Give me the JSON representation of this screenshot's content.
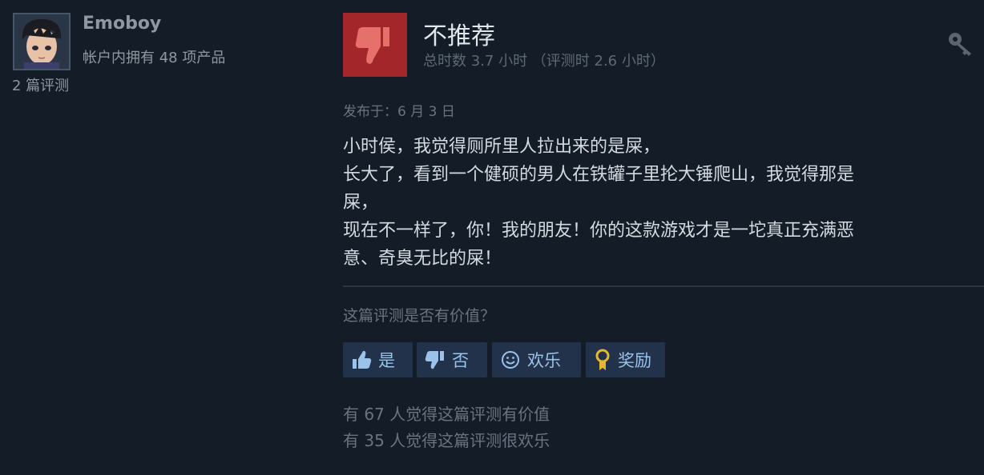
{
  "user": {
    "name": "Emoboy",
    "products_owned": "帐户内拥有 48 项产品",
    "review_count": "2 篇评测"
  },
  "review": {
    "verdict": "不推荐",
    "hours": "总时数 3.7 小时 （评测时 2.6 小时）",
    "posted": "发布于：6 月 3 日",
    "body_lines": [
      "小时侯，我觉得厕所里人拉出来的是屎，",
      "长大了，看到一个健硕的男人在铁罐子里抡大锤爬山，我觉得那是",
      "屎，",
      "现在不一样了，你！我的朋友！你的这款游戏才是一坨真正充满恶",
      "意、奇臭无比的屎！"
    ]
  },
  "feedback": {
    "question": "这篇评测是否有价值？",
    "yes_label": "是",
    "no_label": "否",
    "funny_label": "欢乐",
    "award_label": "奖励",
    "helpful_stat": "有 67 人觉得这篇评测有价值",
    "funny_stat": "有 35 人觉得这篇评测很欢乐"
  },
  "colors": {
    "background": "#141c27",
    "thumb_down_bg": "#a3262b",
    "thumb_down_fg": "#e6706a",
    "button_bg": "#22324a",
    "button_text": "#9bc2e8",
    "award_icon": "#e6b830"
  },
  "icons": {
    "verdict": "thumbs-down-icon",
    "settings": "key-icon",
    "yes": "thumbs-up-icon",
    "no": "thumbs-down-icon",
    "funny": "smiley-icon",
    "award": "award-ribbon-icon"
  }
}
